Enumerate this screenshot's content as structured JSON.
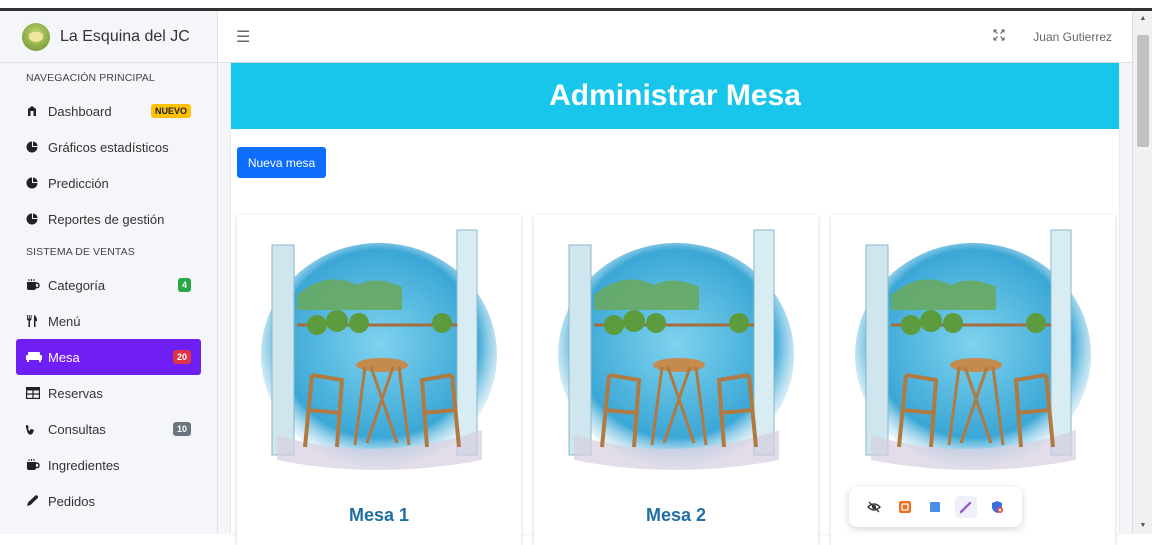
{
  "brand": {
    "title": "La Esquina del JC"
  },
  "header": {
    "user_name": "Juan Gutierrez"
  },
  "sidebar": {
    "sections": [
      {
        "header": "NAVEGACIÓN PRINCIPAL",
        "items": [
          {
            "label": "Dashboard",
            "icon": "dashboard-icon",
            "badge": "NUEVO",
            "badge_color": "#ffc107"
          },
          {
            "label": "Gráficos estadísticos",
            "icon": "pie-chart-icon"
          },
          {
            "label": "Predicción",
            "icon": "pie-chart-icon"
          },
          {
            "label": "Reportes de gestión",
            "icon": "pie-chart-icon"
          }
        ]
      },
      {
        "header": "SISTEMA DE VENTAS",
        "items": [
          {
            "label": "Categoría",
            "icon": "mug-icon",
            "badge": "4",
            "badge_color": "#28a745"
          },
          {
            "label": "Menú",
            "icon": "utensils-icon"
          },
          {
            "label": "Mesa",
            "icon": "couch-icon",
            "badge": "20",
            "badge_color": "#dc3545",
            "active": true
          },
          {
            "label": "Reservas",
            "icon": "table-icon"
          },
          {
            "label": "Consultas",
            "icon": "phone-icon",
            "badge": "10",
            "badge_color": "#6c757d"
          },
          {
            "label": "Ingredientes",
            "icon": "mug-icon"
          },
          {
            "label": "Pedidos",
            "icon": "pen-icon"
          }
        ]
      }
    ]
  },
  "main": {
    "title": "Administrar Mesa",
    "new_button": "Nueva mesa",
    "tables": [
      "Mesa 1",
      "Mesa 2"
    ]
  },
  "colors": {
    "accent": "#6f1ef3",
    "banner": "#17c6ea",
    "primary_button": "#0d6efd",
    "table_title": "#1f6fa6"
  }
}
